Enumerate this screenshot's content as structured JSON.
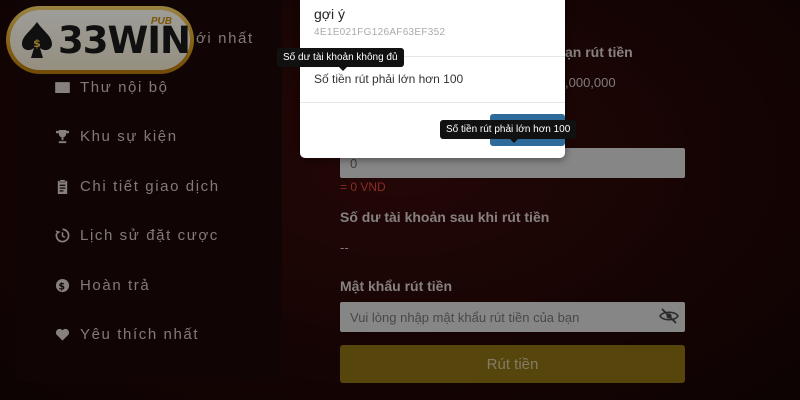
{
  "logo": {
    "text": "33WIN",
    "badge": "PUB"
  },
  "sidebar": {
    "partial_item": "ới nhất",
    "items": [
      {
        "label": "Thư nội bộ",
        "icon": "envelope-icon"
      },
      {
        "label": "Khu sự kiện",
        "icon": "trophy-icon"
      },
      {
        "label": "Chi tiết giao dịch",
        "icon": "clipboard-icon"
      },
      {
        "label": "Lịch sử đặt cược",
        "icon": "history-icon"
      },
      {
        "label": "Hoàn trả",
        "icon": "dollar-circle-icon"
      },
      {
        "label": "Yêu thích nhất",
        "icon": "heart-icon"
      }
    ]
  },
  "form": {
    "partial_label": "ạn rút tiền",
    "partial_amount": ",000,000",
    "amount_value": "0",
    "amount_vnd": "= 0 VND",
    "balance_after_label": "Số dư tài khoản sau khi rút tiền",
    "balance_after_value": "--",
    "password_label": "Mật khẩu rút tiền",
    "password_placeholder": "Vui lòng nhập mật khẩu rút tiền của bạn",
    "submit_label": "Rút tiền"
  },
  "modal": {
    "title": "gợi ý",
    "code": "4E1E021FG126AF63EF352",
    "message": "Số tiền rút phải lớn hơn 100"
  },
  "tooltips": {
    "balance_insufficient": "Số dư tài khoản không đủ",
    "min_amount": "Số tiền rút phải lớn hơn 100"
  },
  "colors": {
    "background": "#240807",
    "accent_gold": "#8c7212",
    "error_red": "#e0463a",
    "modal_button": "#2f6b9a"
  }
}
